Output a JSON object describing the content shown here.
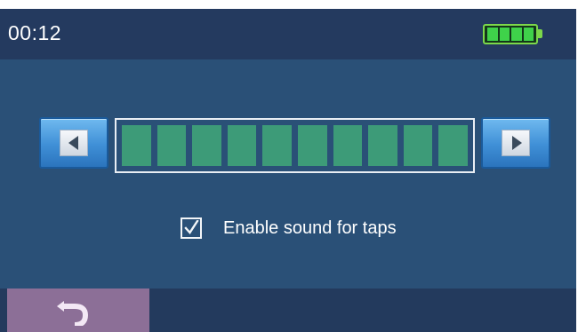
{
  "status_bar": {
    "time": "00:12",
    "battery_icon": "battery-full-icon",
    "battery_level": 1.0
  },
  "volume": {
    "decrease_icon": "left-arrow-icon",
    "increase_icon": "right-arrow-icon",
    "level": 10,
    "max": 10
  },
  "sound_setting": {
    "label": "Enable sound for taps",
    "checked": true
  },
  "bottom_bar": {
    "back_icon": "back-arrow-icon"
  },
  "colors": {
    "screen_bg": "#2a5077",
    "bar_bg": "#233a5d",
    "segment": "#3d9b78",
    "battery": "#3fd24a",
    "back_button": "#8c6f97"
  }
}
